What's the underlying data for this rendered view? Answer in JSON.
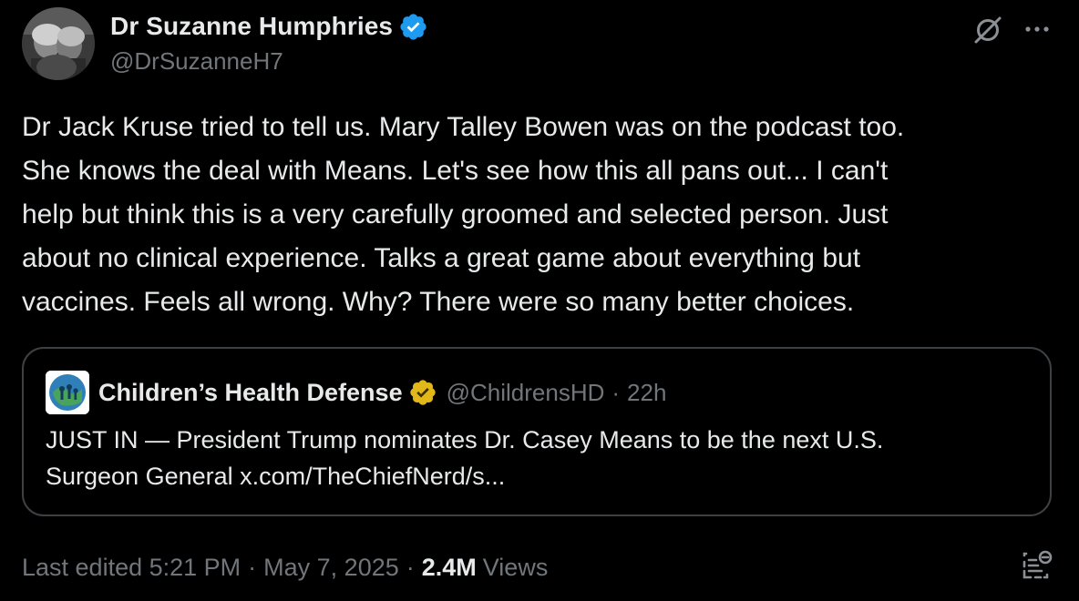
{
  "author": {
    "display_name": "Dr Suzanne Humphries",
    "handle": "@DrSuzanneH7",
    "verified_icon": "verified-badge-icon",
    "verified_color": "#1d9bf0"
  },
  "actions": {
    "grok_icon": "grok-icon",
    "more_icon": "more-options-icon"
  },
  "post": {
    "text": "Dr Jack Kruse tried to tell us. Mary Talley Bowen was on the podcast too.\nShe knows the deal with Means. Let's see how this all pans out... I can't\nhelp but think this is a very carefully groomed and selected person. Just\nabout no clinical experience. Talks a great game about everything but\nvaccines. Feels all wrong. Why? There were so many better choices."
  },
  "quote": {
    "display_name": "Children’s Health Defense",
    "badge_icon": "gold-verified-badge-icon",
    "badge_color": "#e2b719",
    "handle": "@ChildrensHD",
    "separator": "·",
    "time": "22h",
    "text": "JUST IN — President Trump nominates Dr. Casey Means to be the next U.S.\nSurgeon General x.com/TheChiefNerd/s..."
  },
  "footer": {
    "edited_label": "Last edited 5:21 PM",
    "sep1": "·",
    "date": "May 7, 2025",
    "sep2": "·",
    "views_count": "2.4M",
    "views_label": "Views",
    "analytics_icon": "analytics-icon"
  },
  "colors": {
    "background": "#000000",
    "primary_text": "#e7e9ea",
    "secondary_text": "#71767b",
    "border": "#3e4144"
  }
}
